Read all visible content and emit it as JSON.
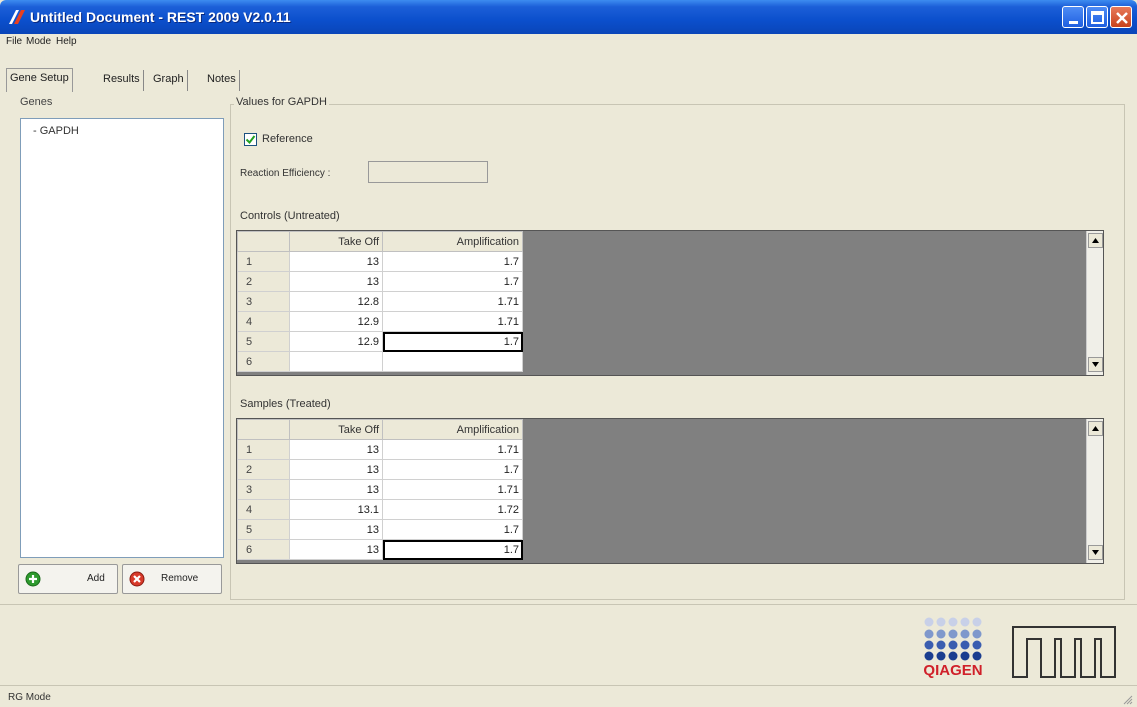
{
  "window": {
    "title": "Untitled Document - REST 2009 V2.0.11"
  },
  "menu": [
    "File",
    "Mode",
    "Help"
  ],
  "tabs": [
    "Gene Setup",
    "Results",
    "Graph",
    "Notes"
  ],
  "genes": {
    "label": "Genes",
    "items": [
      "- GAPDH"
    ],
    "add_label": "Add",
    "remove_label": "Remove"
  },
  "values": {
    "group_title": "Values for GAPDH",
    "reference_label": "Reference",
    "reference_checked": true,
    "efficiency_label": "Reaction Efficiency :",
    "efficiency_value": ""
  },
  "columns": [
    "Take Off",
    "Amplification"
  ],
  "controls": {
    "label": "Controls (Untreated)",
    "rows": [
      [
        "1",
        "13",
        "1.7"
      ],
      [
        "2",
        "13",
        "1.7"
      ],
      [
        "3",
        "12.8",
        "1.71"
      ],
      [
        "4",
        "12.9",
        "1.71"
      ],
      [
        "5",
        "12.9",
        "1.7"
      ],
      [
        "6",
        "",
        ""
      ]
    ]
  },
  "samples": {
    "label": "Samples (Treated)",
    "rows": [
      [
        "1",
        "13",
        "1.71"
      ],
      [
        "2",
        "13",
        "1.7"
      ],
      [
        "3",
        "13",
        "1.71"
      ],
      [
        "4",
        "13.1",
        "1.72"
      ],
      [
        "5",
        "13",
        "1.7"
      ],
      [
        "6",
        "13",
        "1.7"
      ]
    ]
  },
  "logos": {
    "qiagen": "QIAGEN"
  },
  "status": {
    "mode": "RG Mode"
  },
  "colors": {
    "titlebar": "#0b4fcc",
    "grid_bg": "#808080",
    "qiagen_blue": "#1a3d8f",
    "qiagen_red": "#d0202a"
  }
}
